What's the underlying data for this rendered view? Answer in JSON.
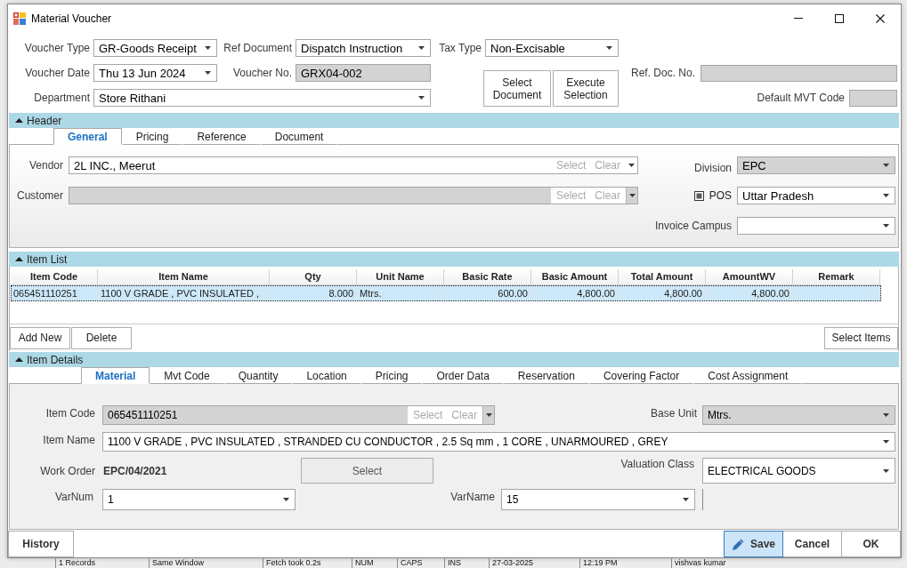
{
  "window": {
    "title": "Material Voucher"
  },
  "voucher": {
    "voucher_type": {
      "label": "Voucher Type",
      "value": "GR-Goods Receipt",
      "kind": "combo",
      "disabled": false
    },
    "ref_document": {
      "label": "Ref Document",
      "value": "Dispatch Instruction",
      "kind": "combo",
      "disabled": false
    },
    "tax_type": {
      "label": "Tax Type",
      "value": "Non-Excisable",
      "kind": "combo",
      "disabled": false
    },
    "voucher_date": {
      "label": "Voucher Date",
      "value": "Thu 13 Jun 2024",
      "kind": "combo",
      "disabled": false
    },
    "voucher_no": {
      "label": "Voucher No.",
      "value": "GRX04-002",
      "kind": "text",
      "disabled": true
    },
    "department": {
      "label": "Department",
      "value": "Store Rithani",
      "kind": "combo",
      "disabled": false
    },
    "buttons": [
      "Select Document",
      "Execute Selection"
    ],
    "ref_doc_no": {
      "label": "Ref. Doc. No.",
      "kind": "text",
      "disabled": true
    },
    "default_mvt_code": {
      "label": "Default MVT Code",
      "kind": "text",
      "disabled": true
    }
  },
  "header_section": {
    "title": "Header",
    "expanded": true,
    "tabs": [
      {
        "label": "General",
        "selected": true
      },
      {
        "label": "Pricing",
        "selected": false
      },
      {
        "label": "Reference",
        "selected": false
      },
      {
        "label": "Document",
        "selected": false
      }
    ],
    "vendor": {
      "label": "Vendor",
      "value": "2L INC., Meerut",
      "kind": "lookup",
      "actions": [
        "Select",
        "Clear"
      ],
      "disabled": false
    },
    "customer": {
      "label": "Customer",
      "kind": "lookup",
      "actions": [
        "Select",
        "Clear"
      ],
      "disabled": true
    },
    "division": {
      "label": "Division",
      "value": "EPC",
      "kind": "combo",
      "disabled": true
    },
    "pos": {
      "label": "POS",
      "checked": false,
      "indeterminate": true,
      "value": "Uttar Pradesh",
      "kind": "combo",
      "disabled": false
    },
    "invoice_campus": {
      "label": "Invoice Campus",
      "kind": "combo",
      "disabled": false
    }
  },
  "item_list": {
    "title": "Item List",
    "expanded": true,
    "columns": [
      {
        "label": "Item Code",
        "kind": "text"
      },
      {
        "label": "Item Name",
        "kind": "text"
      },
      {
        "label": "Qty",
        "kind": "number"
      },
      {
        "label": "Unit Name",
        "kind": "text"
      },
      {
        "label": "Basic Rate",
        "kind": "number"
      },
      {
        "label": "Basic Amount",
        "kind": "number"
      },
      {
        "label": "Total Amount",
        "kind": "number"
      },
      {
        "label": "AmountWV",
        "kind": "number"
      },
      {
        "label": "Remark",
        "kind": "text"
      }
    ],
    "rows": [
      {
        "selected": true,
        "cells": [
          "065451110251",
          "1100 V GRADE , PVC INSULATED ,",
          "8.000",
          "Mtrs.",
          "600.00",
          "4,800.00",
          "4,800.00",
          "4,800.00"
        ]
      }
    ],
    "buttons": [
      "Add New",
      "Delete"
    ],
    "side_button": "Select Items"
  },
  "item_details": {
    "title": "Item Details",
    "expanded": true,
    "tabs": [
      {
        "label": "Material",
        "selected": true
      },
      {
        "label": "Mvt Code",
        "selected": false
      },
      {
        "label": "Quantity",
        "selected": false
      },
      {
        "label": "Location",
        "selected": false
      },
      {
        "label": "Pricing",
        "selected": false
      },
      {
        "label": "Order Data",
        "selected": false
      },
      {
        "label": "Reservation",
        "selected": false
      },
      {
        "label": "Covering Factor",
        "selected": false
      },
      {
        "label": "Cost Assignment",
        "selected": false
      }
    ],
    "item_code": {
      "label": "Item Code",
      "value": "065451110251",
      "kind": "lookup",
      "actions": [
        "Select",
        "Clear"
      ],
      "disabled": true
    },
    "base_unit": {
      "label": "Base Unit",
      "value": "Mtrs.",
      "kind": "combo",
      "disabled": true
    },
    "item_name": {
      "label": "Item Name",
      "value": "1100 V GRADE , PVC INSULATED , STRANDED CU CONDUCTOR , 2.5 Sq mm , 1 CORE , UNARMOURED , GREY",
      "kind": "combo",
      "disabled": false
    },
    "work_order": {
      "label": "Work Order",
      "value": "EPC/04/2021"
    },
    "select_button": "Select",
    "valuation_class": {
      "label": "Valuation Class",
      "value": "ELECTRICAL GOODS",
      "kind": "combo",
      "disabled": false
    },
    "var_num": {
      "label": "VarNum",
      "value": "1",
      "kind": "combo",
      "disabled": false
    },
    "var_name": {
      "label": "VarName",
      "value": "15",
      "kind": "combo",
      "disabled": false
    }
  },
  "footer": {
    "left_buttons": [
      "History"
    ],
    "right_buttons": [
      {
        "label": "Save",
        "kind": "icon",
        "focused": true
      },
      {
        "label": "Cancel",
        "kind": "plain",
        "focused": false
      },
      {
        "label": "OK",
        "kind": "plain",
        "focused": false
      }
    ]
  },
  "status_bar": [
    "1 Records",
    "Same Window",
    "Fetch took 0.2s",
    "NUM",
    "CAPS",
    "INS",
    "27-03-2025",
    "12:19 PM",
    "vishvas kumar"
  ]
}
